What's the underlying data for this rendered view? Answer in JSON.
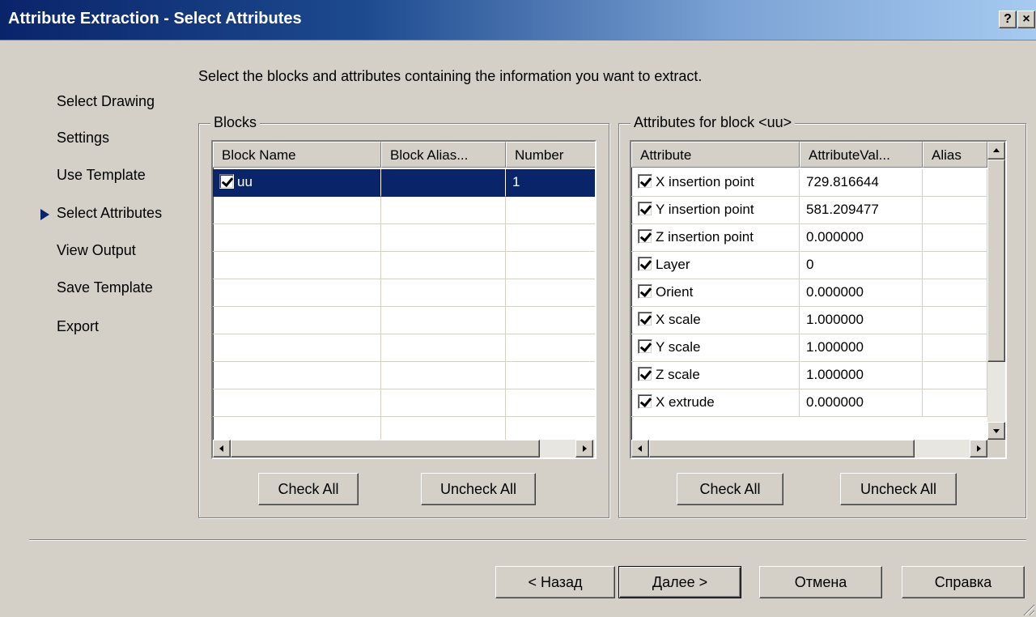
{
  "window": {
    "title": "Attribute Extraction - Select Attributes",
    "help_label": "?",
    "close_label": "×"
  },
  "steps": [
    {
      "label": "Select Drawing"
    },
    {
      "label": "Settings"
    },
    {
      "label": "Use Template"
    },
    {
      "label": "Select Attributes",
      "current": true
    },
    {
      "label": "View Output"
    },
    {
      "label": "Save Template"
    },
    {
      "label": "Export"
    }
  ],
  "instruction": "Select the blocks and attributes containing the information you want to extract.",
  "blocks": {
    "group_label": "Blocks",
    "columns": [
      "Block Name",
      "Block Alias...",
      "Number"
    ],
    "rows": [
      {
        "name": "uu",
        "alias": "",
        "number": "1",
        "checked": true,
        "selected": true
      }
    ],
    "check_all": "Check All",
    "uncheck_all": "Uncheck All"
  },
  "attributes": {
    "group_label": "Attributes for block <uu>",
    "columns": [
      "Attribute",
      "AttributeVal...",
      "Alias"
    ],
    "rows": [
      {
        "name": "X insertion point",
        "value": "729.816644",
        "checked": true
      },
      {
        "name": "Y insertion point",
        "value": "581.209477",
        "checked": true
      },
      {
        "name": "Z insertion point",
        "value": "0.000000",
        "checked": true
      },
      {
        "name": "Layer",
        "value": "0",
        "checked": true
      },
      {
        "name": "Orient",
        "value": "0.000000",
        "checked": true
      },
      {
        "name": "X scale",
        "value": "1.000000",
        "checked": true
      },
      {
        "name": "Y scale",
        "value": "1.000000",
        "checked": true
      },
      {
        "name": "Z scale",
        "value": "1.000000",
        "checked": true
      },
      {
        "name": "X extrude",
        "value": "0.000000",
        "checked": true
      }
    ],
    "check_all": "Check All",
    "uncheck_all": "Uncheck All"
  },
  "footer": {
    "back": "< Назад",
    "next": "Далее >",
    "cancel": "Отмена",
    "help": "Справка"
  },
  "colors": {
    "selection": "#0a246a",
    "dialog_bg": "#d4d0c8"
  }
}
